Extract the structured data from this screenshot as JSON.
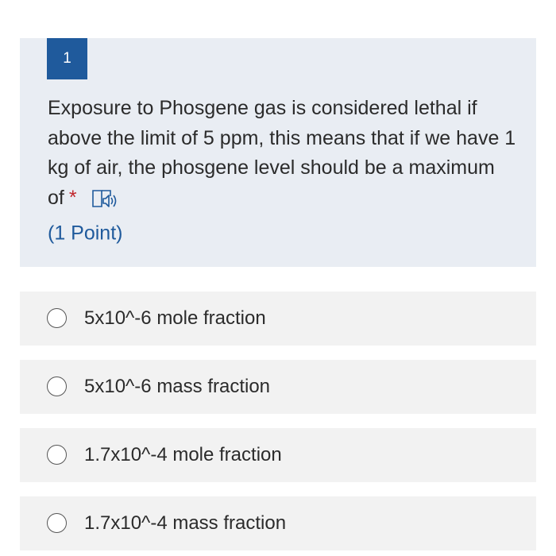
{
  "question": {
    "number": "1",
    "text": "Exposure to Phosgene gas is considered lethal if above the limit of 5 ppm, this means that if we have 1 kg of air, the phosgene level should be a maximum of",
    "required_marker": "*",
    "points": "(1 Point)",
    "speaker_icon": "immersive-reader-icon"
  },
  "options": [
    {
      "label": "5x10^-6 mole fraction",
      "selected": false
    },
    {
      "label": "5x10^-6 mass fraction",
      "selected": false
    },
    {
      "label": "1.7x10^-4 mole fraction",
      "selected": false
    },
    {
      "label": "1.7x10^-4 mass fraction",
      "selected": false
    }
  ],
  "colors": {
    "accent": "#1f5a9c",
    "question_bg": "#e9edf3",
    "option_bg": "#f2f2f2",
    "required": "#c1272d"
  }
}
